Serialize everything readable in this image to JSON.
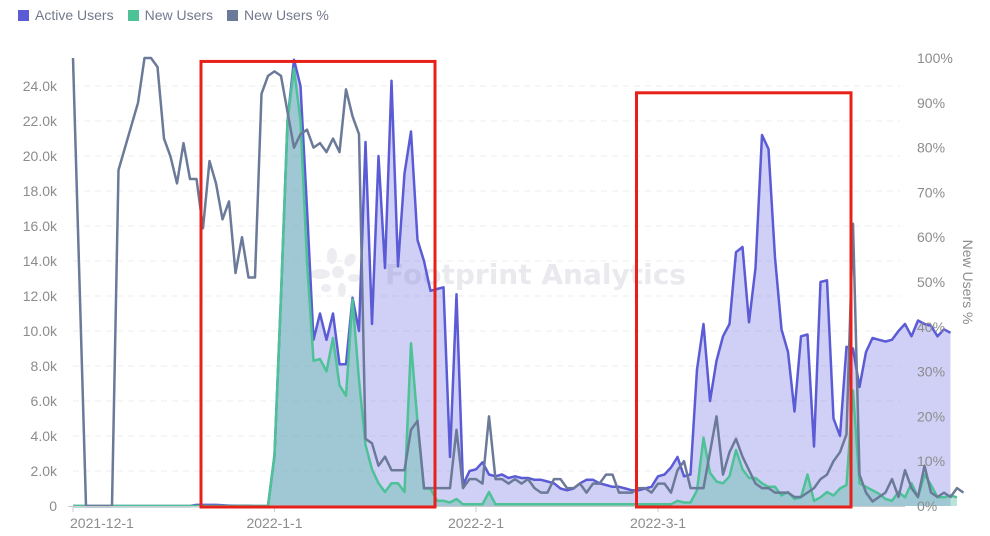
{
  "chart_data": {
    "type": "area",
    "title": "",
    "watermark": "Footprint Analytics",
    "legend_position": "top-left",
    "legend": [
      {
        "name": "Active Users",
        "color": "#5b5bd6"
      },
      {
        "name": "New Users",
        "color": "#4dc296"
      },
      {
        "name": "New Users %",
        "color": "#6b7a99"
      }
    ],
    "x_start": "2021-12-01",
    "x_end": "2022-03-30",
    "x_tick_labels": [
      "2021-12-1",
      "2022-1-1",
      "2022-2-1",
      "2022-3-1"
    ],
    "x_tick_days": [
      0,
      31,
      62,
      90
    ],
    "y_left": {
      "label": "",
      "range": [
        0,
        25500
      ],
      "ticks": [
        0,
        2000,
        4000,
        6000,
        8000,
        10000,
        12000,
        14000,
        16000,
        18000,
        20000,
        22000,
        24000
      ],
      "tick_labels": [
        "0",
        "2.0k",
        "4.0k",
        "6.0k",
        "8.0k",
        "10.0k",
        "12.0k",
        "14.0k",
        "16.0k",
        "18.0k",
        "20.0k",
        "22.0k",
        "24.0k"
      ]
    },
    "y_right": {
      "label": "New Users %",
      "range": [
        0,
        100
      ],
      "ticks": [
        0,
        10,
        20,
        30,
        40,
        50,
        60,
        70,
        80,
        90,
        100
      ],
      "tick_labels": [
        "0%",
        "10%",
        "20%",
        "30%",
        "40%",
        "50%",
        "60%",
        "70%",
        "80%",
        "90%",
        "100%"
      ]
    },
    "grid": true,
    "series": [
      {
        "name": "Active Users",
        "axis": "left",
        "values": [
          0,
          0,
          0,
          0,
          0,
          0,
          0,
          0,
          0,
          0,
          0,
          0,
          0,
          0,
          0,
          0,
          0,
          0,
          0,
          60,
          60,
          60,
          60,
          40,
          20,
          10,
          10,
          10,
          0,
          0,
          0,
          2900,
          12000,
          22000,
          25500,
          24000,
          17000,
          9500,
          11000,
          9500,
          11000,
          8100,
          8100,
          11900,
          10000,
          20800,
          10400,
          20000,
          13600,
          24300,
          13700,
          19000,
          21400,
          15200,
          14000,
          12300,
          12400,
          12500,
          2800,
          12100,
          1200,
          2000,
          2100,
          2500,
          1800,
          1700,
          1800,
          1600,
          1700,
          1600,
          1600,
          1500,
          1500,
          1400,
          1300,
          1000,
          900,
          1000,
          1300,
          1500,
          1500,
          1300,
          1200,
          1100,
          1100,
          1000,
          900,
          900,
          1000,
          1100,
          1700,
          1800,
          2200,
          2800,
          1700,
          1800,
          7800,
          10400,
          6000,
          8300,
          9700,
          10400,
          14500,
          14800,
          10500,
          13600,
          21200,
          20400,
          14200,
          10100,
          8800,
          5400,
          9700,
          9800,
          3400,
          12800,
          12900,
          5000,
          4000,
          9100,
          9000,
          6800,
          8800,
          9600,
          9500,
          9400,
          9500,
          10000,
          10400,
          9700,
          10600,
          10400,
          10300,
          9700,
          10100,
          9900
        ]
      },
      {
        "name": "New Users",
        "axis": "left",
        "values": [
          0,
          0,
          0,
          0,
          0,
          0,
          0,
          0,
          0,
          0,
          0,
          0,
          0,
          0,
          0,
          0,
          0,
          0,
          0,
          0,
          0,
          0,
          0,
          0,
          0,
          0,
          0,
          0,
          0,
          0,
          0,
          2900,
          12000,
          22000,
          25000,
          22000,
          14000,
          8300,
          8400,
          7700,
          9600,
          6900,
          6300,
          11800,
          7200,
          3500,
          2100,
          1300,
          800,
          1300,
          1300,
          800,
          9300,
          4800,
          1000,
          1000,
          300,
          300,
          200,
          400,
          100,
          100,
          100,
          100,
          800,
          100,
          100,
          100,
          100,
          100,
          100,
          100,
          100,
          100,
          100,
          100,
          100,
          100,
          100,
          100,
          100,
          100,
          100,
          100,
          100,
          100,
          100,
          100,
          100,
          100,
          100,
          100,
          100,
          300,
          200,
          200,
          900,
          3900,
          1900,
          1400,
          1300,
          1700,
          3200,
          2100,
          1600,
          1600,
          1300,
          1100,
          1100,
          600,
          800,
          400,
          500,
          1800,
          300,
          500,
          800,
          600,
          1000,
          1200,
          6600,
          1300,
          1100,
          900,
          700,
          400,
          300,
          800,
          500,
          1300,
          500,
          1800,
          1200,
          500,
          500,
          600,
          500
        ]
      },
      {
        "name": "New Users %",
        "axis": "right",
        "values": [
          100,
          50,
          0,
          0,
          0,
          0,
          0,
          75,
          80,
          85,
          90,
          100,
          100,
          98,
          82,
          78,
          72,
          81,
          73,
          73,
          62,
          77,
          72,
          64,
          68,
          52,
          60,
          51,
          51,
          92,
          96,
          97,
          96,
          88,
          80,
          83,
          84,
          80,
          81,
          79,
          82,
          79,
          93,
          87,
          83,
          15,
          14,
          9,
          11,
          8,
          8,
          8,
          17,
          19,
          4,
          4,
          4,
          4,
          4,
          17,
          4,
          6,
          6,
          5,
          20,
          6,
          6,
          5,
          6,
          5,
          6,
          4,
          3,
          3,
          6,
          6,
          4,
          4,
          5,
          3,
          5,
          5,
          7,
          7,
          3,
          3,
          3,
          4,
          4,
          3,
          5,
          5,
          3,
          8,
          10,
          4,
          4,
          4,
          12,
          20,
          7,
          12,
          15,
          11,
          8,
          5,
          4,
          4,
          3,
          3,
          3,
          2,
          2,
          3,
          4,
          6,
          7,
          10,
          12,
          16,
          63,
          7,
          3,
          1,
          2,
          3,
          6,
          2,
          8,
          4,
          2,
          9,
          3,
          2,
          3,
          2,
          4,
          3
        ]
      }
    ]
  },
  "annotations": [
    {
      "type": "highlight-box",
      "color": "#e8201a",
      "from": "2021-12-21",
      "to": "2022-01-26",
      "y_top_pct": 97
    },
    {
      "type": "highlight-box",
      "color": "#e8201a",
      "from": "2022-02-26",
      "to": "2022-03-31",
      "y_top_pct": 90
    }
  ]
}
